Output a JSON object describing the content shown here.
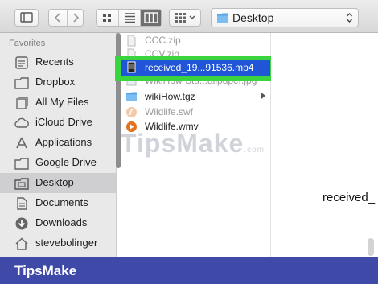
{
  "toolbar": {
    "location": "Desktop"
  },
  "sidebar": {
    "section": "Favorites",
    "items": [
      {
        "label": "Recents",
        "icon": "recents-icon"
      },
      {
        "label": "Dropbox",
        "icon": "dropbox-folder-icon"
      },
      {
        "label": "All My Files",
        "icon": "all-files-icon"
      },
      {
        "label": "iCloud Drive",
        "icon": "cloud-icon"
      },
      {
        "label": "Applications",
        "icon": "applications-icon"
      },
      {
        "label": "Google Drive",
        "icon": "folder-icon"
      },
      {
        "label": "Desktop",
        "icon": "desktop-folder-icon",
        "selected": true
      },
      {
        "label": "Documents",
        "icon": "documents-icon"
      },
      {
        "label": "Downloads",
        "icon": "downloads-icon"
      },
      {
        "label": "stevebolinger",
        "icon": "home-icon"
      }
    ]
  },
  "files": {
    "items": [
      {
        "name": "CCC.zip"
      },
      {
        "name": "CCV.zip"
      },
      {
        "name": "received_19...91536.mp4",
        "selected": true
      },
      {
        "name": "WikiHow Sta...allpaper.jpg"
      },
      {
        "name": "wikiHow.tgz",
        "has_children": true
      },
      {
        "name": "Wildlife.swf"
      },
      {
        "name": "Wildlife.wmv"
      }
    ]
  },
  "preview": {
    "filename": "received_"
  },
  "watermark": {
    "text": "TipsMake",
    "suffix": ".com"
  },
  "banner": {
    "text": "TipsMake"
  },
  "colors": {
    "selection": "#1f55d6",
    "highlight": "#3ad43f",
    "banner": "#3f4aa8"
  }
}
